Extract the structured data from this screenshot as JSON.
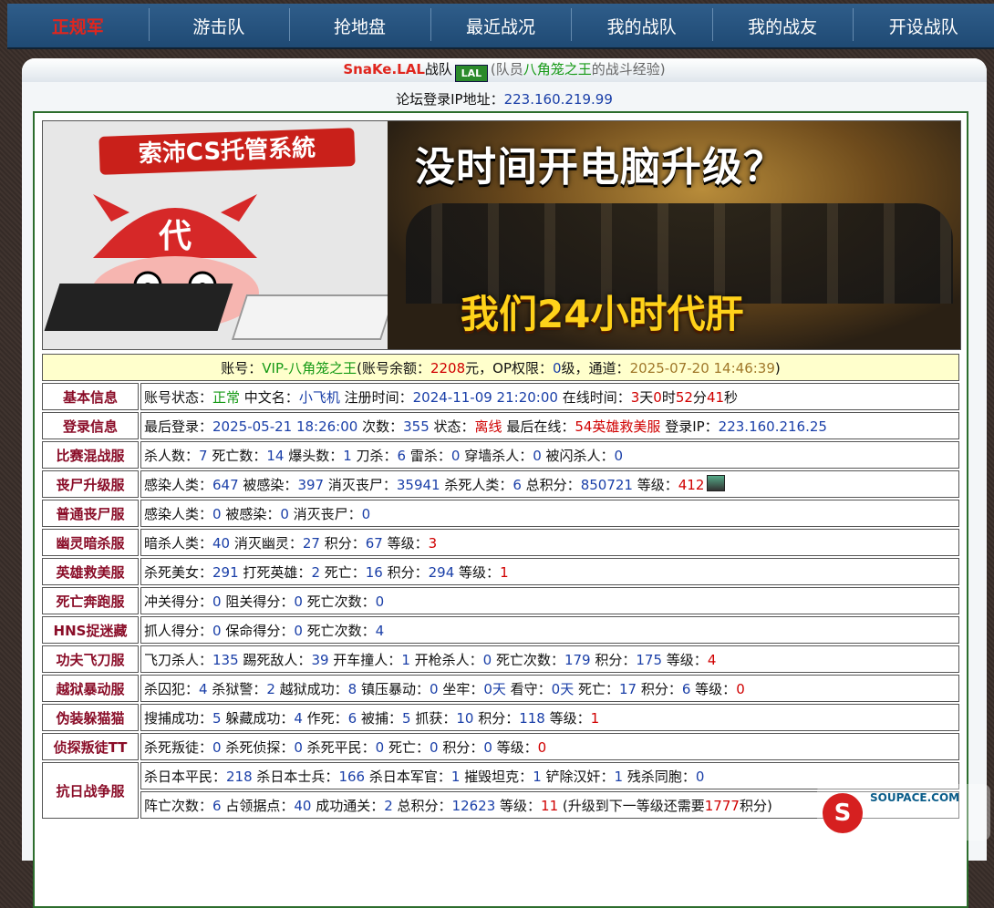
{
  "nav": [
    {
      "label": "正规军",
      "active": true
    },
    {
      "label": "游击队"
    },
    {
      "label": "抢地盘"
    },
    {
      "label": "最近战况"
    },
    {
      "label": "我的战队"
    },
    {
      "label": "我的战友"
    },
    {
      "label": "开设战队"
    }
  ],
  "team": {
    "clan": "SnaKe.LAL",
    "clan_suffix": "战队",
    "badge": "LAL",
    "paren_open": "(队员",
    "member": "八角笼之王",
    "paren_close": "的战斗经验)"
  },
  "ip": {
    "label": "论坛登录IP地址：",
    "value": "223.160.219.99"
  },
  "banner": {
    "left_title": "索沛CS托管系統",
    "cap_glyph": "代",
    "headline": "没时间开电脑升级？",
    "subline": "我们24小时代肝"
  },
  "account": {
    "t1": "账号：",
    "name": "VIP-八角笼之王",
    "t2": "(账号余额：",
    "balance": "2208",
    "t3": "元，OP权限：",
    "op": "0",
    "t4": "级，通道：",
    "time": "2025-07-20 14:46:39",
    "t5": ")"
  },
  "rows": [
    {
      "label": "基本信息",
      "segs": [
        [
          "账号状态：",
          ""
        ],
        [
          "正常",
          "g"
        ],
        [
          " 中文名：",
          ""
        ],
        [
          "小飞机",
          "v"
        ],
        [
          " 注册时间：",
          ""
        ],
        [
          "2024-11-09 21:20:00",
          "v"
        ],
        [
          " 在线时间：",
          ""
        ],
        [
          "3",
          "r"
        ],
        [
          "天",
          ""
        ],
        [
          "0",
          "r"
        ],
        [
          "时",
          ""
        ],
        [
          "52",
          "r"
        ],
        [
          "分",
          ""
        ],
        [
          "41",
          "r"
        ],
        [
          "秒",
          ""
        ]
      ]
    },
    {
      "label": "登录信息",
      "segs": [
        [
          "最后登录：",
          ""
        ],
        [
          "2025-05-21 18:26:00",
          "v"
        ],
        [
          " 次数：",
          ""
        ],
        [
          "355",
          "v"
        ],
        [
          " 状态：",
          ""
        ],
        [
          "离线",
          "r"
        ],
        [
          " 最后在线：",
          ""
        ],
        [
          "54英雄救美服",
          "r"
        ],
        [
          " 登录IP：",
          ""
        ],
        [
          "223.160.216.25",
          "v"
        ]
      ]
    },
    {
      "label": "比赛混战服",
      "segs": [
        [
          "杀人数：",
          ""
        ],
        [
          "7",
          "v"
        ],
        [
          " 死亡数：",
          ""
        ],
        [
          "14",
          "v"
        ],
        [
          " 爆头数：",
          ""
        ],
        [
          "1",
          "v"
        ],
        [
          " 刀杀：",
          ""
        ],
        [
          "6",
          "v"
        ],
        [
          " 雷杀：",
          ""
        ],
        [
          "0",
          "v"
        ],
        [
          " 穿墙杀人：",
          ""
        ],
        [
          "0",
          "v"
        ],
        [
          " 被闪杀人：",
          ""
        ],
        [
          "0",
          "v"
        ]
      ]
    },
    {
      "label": "丧尸升级服",
      "segs": [
        [
          "感染人类：",
          ""
        ],
        [
          "647",
          "v"
        ],
        [
          " 被感染：",
          ""
        ],
        [
          "397",
          "v"
        ],
        [
          " 消灭丧尸：",
          ""
        ],
        [
          "35941",
          "v"
        ],
        [
          " 杀死人类：",
          ""
        ],
        [
          "6",
          "v"
        ],
        [
          " 总积分：",
          ""
        ],
        [
          "850721",
          "v"
        ],
        [
          " 等级：",
          ""
        ],
        [
          "412",
          "r"
        ]
      ],
      "icon": true
    },
    {
      "label": "普通丧尸服",
      "segs": [
        [
          "感染人类：",
          ""
        ],
        [
          "0",
          "v"
        ],
        [
          " 被感染：",
          ""
        ],
        [
          "0",
          "v"
        ],
        [
          " 消灭丧尸：",
          ""
        ],
        [
          "0",
          "v"
        ]
      ]
    },
    {
      "label": "幽灵暗杀服",
      "segs": [
        [
          "暗杀人类：",
          ""
        ],
        [
          "40",
          "v"
        ],
        [
          " 消灭幽灵：",
          ""
        ],
        [
          "27",
          "v"
        ],
        [
          " 积分：",
          ""
        ],
        [
          "67",
          "v"
        ],
        [
          " 等级：",
          ""
        ],
        [
          "3",
          "r"
        ]
      ]
    },
    {
      "label": "英雄救美服",
      "segs": [
        [
          "杀死美女：",
          ""
        ],
        [
          "291",
          "v"
        ],
        [
          " 打死英雄：",
          ""
        ],
        [
          "2",
          "v"
        ],
        [
          " 死亡：",
          ""
        ],
        [
          "16",
          "v"
        ],
        [
          " 积分：",
          ""
        ],
        [
          "294",
          "v"
        ],
        [
          " 等级：",
          ""
        ],
        [
          "1",
          "r"
        ]
      ]
    },
    {
      "label": "死亡奔跑服",
      "segs": [
        [
          "冲关得分：",
          ""
        ],
        [
          "0",
          "v"
        ],
        [
          " 阻关得分：",
          ""
        ],
        [
          "0",
          "v"
        ],
        [
          " 死亡次数：",
          ""
        ],
        [
          "0",
          "v"
        ]
      ]
    },
    {
      "label": "HNS捉迷藏",
      "segs": [
        [
          "抓人得分：",
          ""
        ],
        [
          "0",
          "v"
        ],
        [
          " 保命得分：",
          ""
        ],
        [
          "0",
          "v"
        ],
        [
          " 死亡次数：",
          ""
        ],
        [
          "4",
          "v"
        ]
      ]
    },
    {
      "label": "功夫飞刀服",
      "segs": [
        [
          "飞刀杀人：",
          ""
        ],
        [
          "135",
          "v"
        ],
        [
          " 踢死敌人：",
          ""
        ],
        [
          "39",
          "v"
        ],
        [
          " 开车撞人：",
          ""
        ],
        [
          "1",
          "v"
        ],
        [
          " 开枪杀人：",
          ""
        ],
        [
          "0",
          "v"
        ],
        [
          " 死亡次数：",
          ""
        ],
        [
          "179",
          "v"
        ],
        [
          " 积分：",
          ""
        ],
        [
          "175",
          "v"
        ],
        [
          " 等级：",
          ""
        ],
        [
          "4",
          "r"
        ]
      ]
    },
    {
      "label": "越狱暴动服",
      "segs": [
        [
          "杀囚犯：",
          ""
        ],
        [
          "4",
          "v"
        ],
        [
          " 杀狱警：",
          ""
        ],
        [
          "2",
          "v"
        ],
        [
          " 越狱成功：",
          ""
        ],
        [
          "8",
          "v"
        ],
        [
          " 镇压暴动：",
          ""
        ],
        [
          "0",
          "v"
        ],
        [
          " 坐牢：",
          ""
        ],
        [
          "0天",
          "v"
        ],
        [
          " 看守：",
          ""
        ],
        [
          "0天",
          "v"
        ],
        [
          " 死亡：",
          ""
        ],
        [
          "17",
          "v"
        ],
        [
          " 积分：",
          ""
        ],
        [
          "6",
          "v"
        ],
        [
          " 等级：",
          ""
        ],
        [
          "0",
          "r"
        ]
      ]
    },
    {
      "label": "伪装躲猫猫",
      "segs": [
        [
          "搜捕成功：",
          ""
        ],
        [
          "5",
          "v"
        ],
        [
          " 躲藏成功：",
          ""
        ],
        [
          "4",
          "v"
        ],
        [
          " 作死：",
          ""
        ],
        [
          "6",
          "v"
        ],
        [
          " 被捕：",
          ""
        ],
        [
          "5",
          "v"
        ],
        [
          " 抓获：",
          ""
        ],
        [
          "10",
          "v"
        ],
        [
          " 积分：",
          ""
        ],
        [
          "118",
          "v"
        ],
        [
          " 等级：",
          ""
        ],
        [
          "1",
          "r"
        ]
      ]
    },
    {
      "label": "侦探叛徒TT",
      "segs": [
        [
          "杀死叛徒：",
          ""
        ],
        [
          "0",
          "v"
        ],
        [
          " 杀死侦探：",
          ""
        ],
        [
          "0",
          "v"
        ],
        [
          " 杀死平民：",
          ""
        ],
        [
          "0",
          "v"
        ],
        [
          " 死亡：",
          ""
        ],
        [
          "0",
          "v"
        ],
        [
          " 积分：",
          ""
        ],
        [
          "0",
          "v"
        ],
        [
          " 等级：",
          ""
        ],
        [
          "0",
          "r"
        ]
      ]
    }
  ],
  "anti": {
    "label": "抗日战争服",
    "line1": [
      [
        "杀日本平民：",
        ""
      ],
      [
        "218",
        "v"
      ],
      [
        " 杀日本士兵：",
        ""
      ],
      [
        "166",
        "v"
      ],
      [
        " 杀日本军官：",
        ""
      ],
      [
        "1",
        "v"
      ],
      [
        " 摧毁坦克：",
        ""
      ],
      [
        "1",
        "v"
      ],
      [
        " 铲除汉奸：",
        ""
      ],
      [
        "1",
        "v"
      ],
      [
        " 残杀同胞：",
        ""
      ],
      [
        "0",
        "v"
      ]
    ],
    "line2": [
      [
        "阵亡次数：",
        ""
      ],
      [
        "6",
        "v"
      ],
      [
        " 占领据点：",
        ""
      ],
      [
        "40",
        "v"
      ],
      [
        " 成功通关：",
        ""
      ],
      [
        "2",
        "v"
      ],
      [
        " 总积分：",
        ""
      ],
      [
        "12623",
        "v"
      ],
      [
        " 等级：",
        ""
      ],
      [
        "11",
        "r"
      ],
      [
        " (升级到下一等级还需要",
        ""
      ],
      [
        "1777",
        "r"
      ],
      [
        "积分)",
        ""
      ]
    ]
  },
  "watermark": {
    "site": "SOUPACE.COM",
    "logo": "S"
  },
  "colors": {
    "label": "#8a0d28",
    "value": "#1a3fa8",
    "level": "#d00000",
    "ok": "#169a16",
    "nav_active": "#e0261e"
  }
}
